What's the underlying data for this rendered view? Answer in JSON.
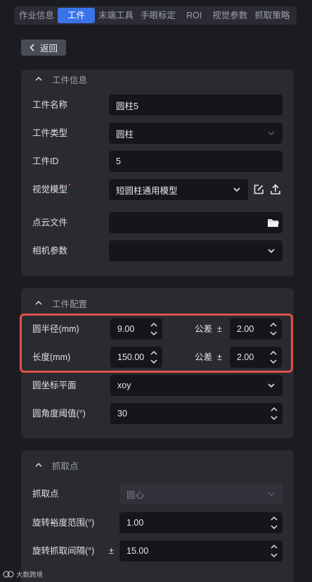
{
  "tabs": [
    {
      "label": "作业信息"
    },
    {
      "label": "工件"
    },
    {
      "label": "末端工具"
    },
    {
      "label": "手眼标定"
    },
    {
      "label": "ROI"
    },
    {
      "label": "视觉参数"
    },
    {
      "label": "抓取策略"
    }
  ],
  "active_tab": "工件",
  "back_label": "返回",
  "workpiece_info": {
    "title": "工件信息",
    "name_label": "工件名称",
    "name_value": "圆柱5",
    "type_label": "工件类型",
    "type_value": "圆柱",
    "id_label": "工件ID",
    "id_value": "5",
    "model_label": "视觉模型",
    "model_required_mark": "*",
    "model_value": "短圆柱通用模型",
    "pointcloud_label": "点云文件",
    "pointcloud_value": "",
    "camera_label": "相机参数",
    "camera_value": ""
  },
  "workpiece_config": {
    "title": "工件配置",
    "radius_label": "圆半径(mm)",
    "radius_value": "9.00",
    "radius_tol_label": "公差",
    "radius_tol_sign": "±",
    "radius_tol_value": "2.00",
    "length_label": "长度(mm)",
    "length_value": "150.00",
    "length_tol_label": "公差",
    "length_tol_sign": "±",
    "length_tol_value": "2.00",
    "plane_label": "圆坐标平面",
    "plane_value": "xoy",
    "angle_label": "圆角度阈值(°)",
    "angle_value": "30"
  },
  "grab_point": {
    "title": "抓取点",
    "point_label": "抓取点",
    "point_value": "圆心",
    "rot_range_label": "旋转裕度范围(°)",
    "rot_range_value": "1.00",
    "rot_interval_label": "旋转抓取间隔(°)",
    "rot_interval_sign": "±",
    "rot_interval_value": "15.00"
  },
  "watermark": {
    "text": "大数跨境"
  },
  "colors": {
    "accent": "#3a72e8",
    "highlight": "#e0524a",
    "panel": "#2a2b31",
    "input": "#15161a"
  }
}
